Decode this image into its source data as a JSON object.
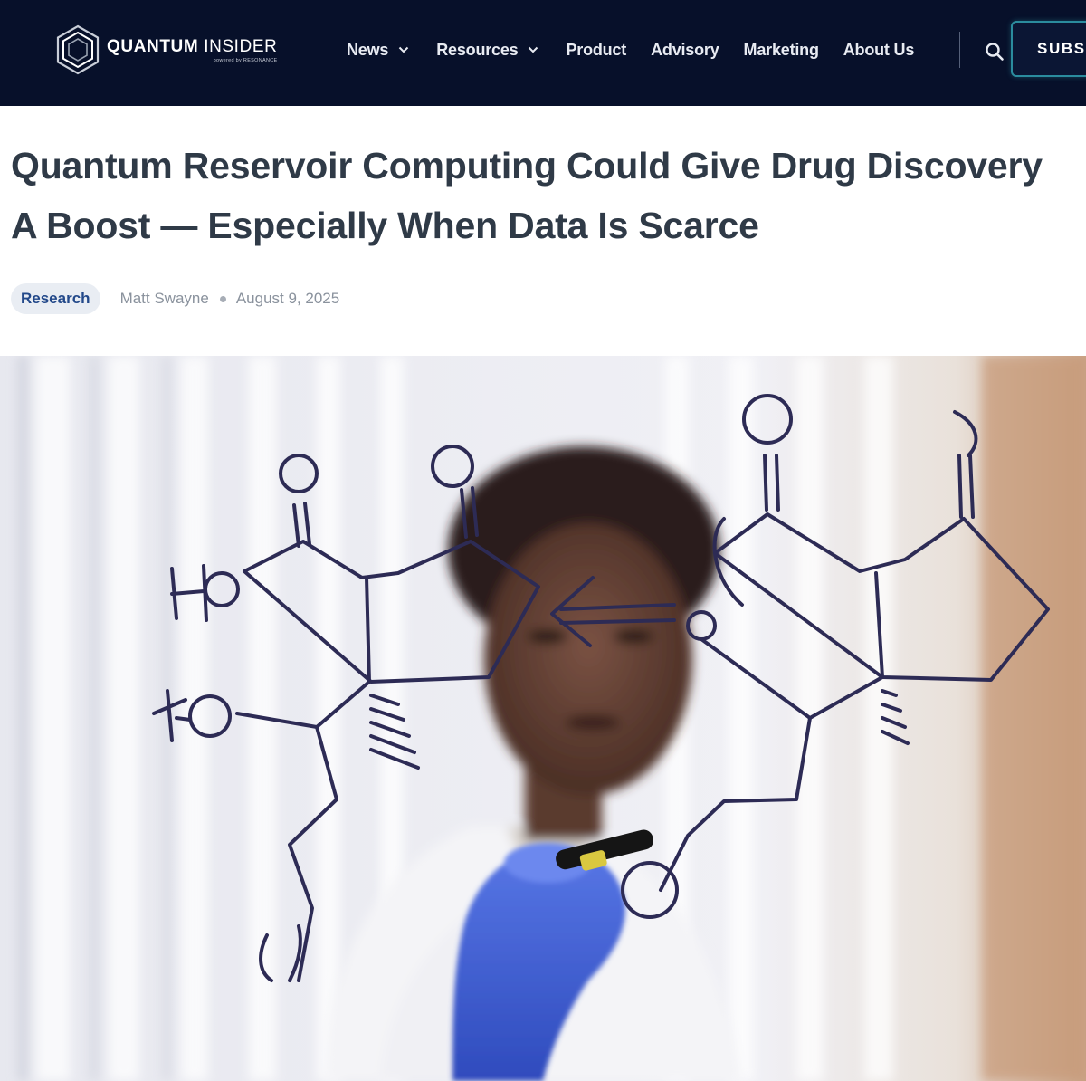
{
  "header": {
    "logo": {
      "name_bold": "QUANTUM",
      "name_light": "INSIDER",
      "tagline": "powered by RESONANCE"
    },
    "nav": [
      {
        "label": "News",
        "has_menu": true
      },
      {
        "label": "Resources",
        "has_menu": true
      },
      {
        "label": "Product",
        "has_menu": false
      },
      {
        "label": "Advisory",
        "has_menu": false
      },
      {
        "label": "Marketing",
        "has_menu": false
      },
      {
        "label": "About Us",
        "has_menu": false
      }
    ],
    "search_icon": "search-icon",
    "subscribe_label": "SUBS",
    "colors": {
      "background": "#07102a",
      "subscribe_border": "#2b8c9e"
    }
  },
  "article": {
    "title_line1": "Quantum Reservoir Computing Could Give Drug Discovery",
    "title_line2": "A Boost — Especially When Data Is Scarce",
    "category": "Research",
    "author": "Matt Swayne",
    "date": "August 9, 2025",
    "hero_molecule_labels": [
      "HO",
      "HO"
    ]
  }
}
